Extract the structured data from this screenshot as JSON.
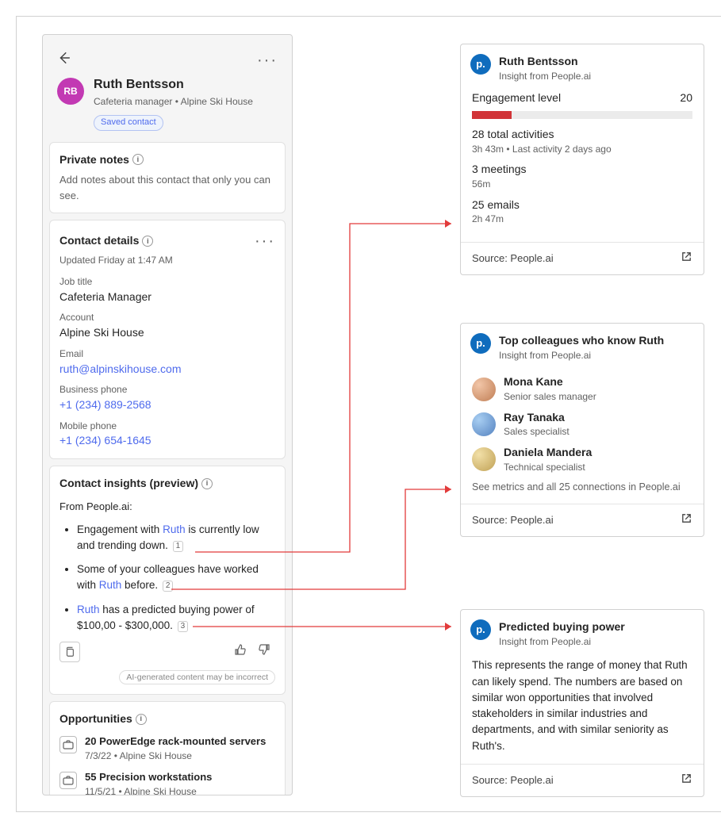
{
  "contact": {
    "initials": "RB",
    "name": "Ruth Bentsson",
    "subtitle": "Cafeteria manager • Alpine Ski House",
    "badge": "Saved contact"
  },
  "notes": {
    "title": "Private notes",
    "placeholder": "Add notes about this contact that only you can see."
  },
  "details": {
    "title": "Contact details",
    "updated": "Updated Friday at 1:47 AM",
    "job_label": "Job title",
    "job_value": "Cafeteria Manager",
    "account_label": "Account",
    "account_value": "Alpine Ski House",
    "email_label": "Email",
    "email_value": "ruth@alpinskihouse.com",
    "bphone_label": "Business phone",
    "bphone_value": "+1 (234) 889-2568",
    "mphone_label": "Mobile phone",
    "mphone_value": "+1 (234) 654-1645"
  },
  "insights": {
    "title": "Contact insights (preview)",
    "from": "From People.ai:",
    "i1a": "Engagement with ",
    "i1name": "Ruth",
    "i1b": " is currently low and trending down.",
    "i1ref": "1",
    "i2a": "Some of your colleagues have worked with ",
    "i2name": "Ruth",
    "i2b": " before.",
    "i2ref": "2",
    "i3name": "Ruth",
    "i3a": " has a predicted buying power of $100,00 - $300,000.",
    "i3ref": "3",
    "disclaimer": "AI-generated content may be incorrect"
  },
  "opps": {
    "title": "Opportunities",
    "o1_title": "20 PowerEdge rack-mounted servers",
    "o1_sub": "7/3/22 • Alpine Ski House",
    "o2_title": "55 Precision workstations",
    "o2_sub": "11/5/21 • Alpine Ski House"
  },
  "rc1": {
    "title": "Ruth Bentsson",
    "sub": "Insight from People.ai",
    "eng_label": "Engagement level",
    "eng_value": "20",
    "eng_pct": 18,
    "s1h": "28 total activities",
    "s1s": "3h 43m • Last activity 2 days ago",
    "s2h": "3 meetings",
    "s2s": "56m",
    "s3h": "25 emails",
    "s3s": "2h 47m",
    "source": "Source: People.ai"
  },
  "rc2": {
    "title": "Top colleagues who know Ruth",
    "sub": "Insight from People.ai",
    "c1n": "Mona Kane",
    "c1r": "Senior sales manager",
    "c2n": "Ray Tanaka",
    "c2r": "Sales specialist",
    "c3n": "Daniela Mandera",
    "c3r": "Technical specialist",
    "more": "See metrics and all 25 connections in People.ai",
    "source": "Source: People.ai"
  },
  "rc3": {
    "title": "Predicted buying power",
    "sub": "Insight from People.ai",
    "desc": "This represents the range of money that Ruth can likely spend. The numbers are based on similar won opportunities that involved stakeholders in similar industries and departments, and with similar seniority as Ruth's.",
    "source": "Source: People.ai"
  }
}
